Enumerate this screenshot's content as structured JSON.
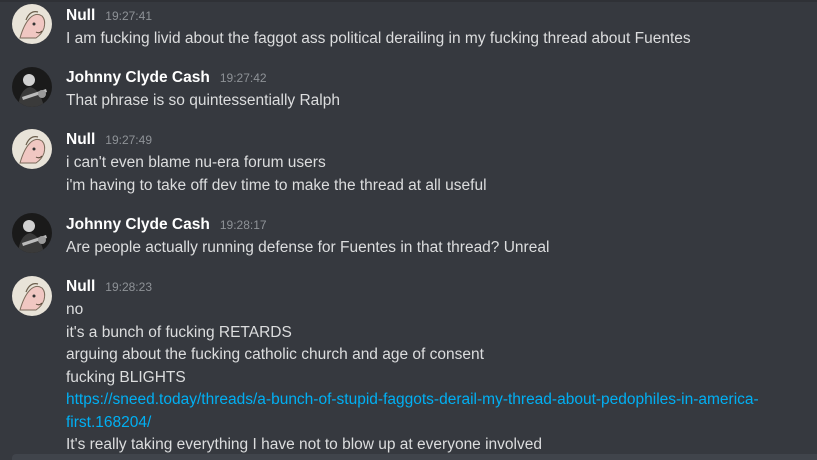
{
  "colors": {
    "background": "#36393f",
    "username": "#ffffff",
    "timestamp": "#8e9297",
    "text": "#dcddde",
    "link": "#00b0f4"
  },
  "messages": [
    {
      "author": "Null",
      "time": "19:27:41",
      "avatar": "pink-sketch-avatar",
      "lines": [
        "I am fucking livid about the faggot ass political derailing in my fucking thread about Fuentes"
      ]
    },
    {
      "author": "Johnny Clyde Cash",
      "time": "19:27:42",
      "avatar": "guitar-player-avatar",
      "lines": [
        "That phrase is so quintessentially Ralph"
      ]
    },
    {
      "author": "Null",
      "time": "19:27:49",
      "avatar": "pink-sketch-avatar",
      "lines": [
        "i can't even blame nu-era forum users",
        "i'm having to take off dev time to make the thread at all useful"
      ]
    },
    {
      "author": "Johnny Clyde Cash",
      "time": "19:28:17",
      "avatar": "guitar-player-avatar",
      "lines": [
        "Are people actually running defense for Fuentes in that thread? Unreal"
      ]
    },
    {
      "author": "Null",
      "time": "19:28:23",
      "avatar": "pink-sketch-avatar",
      "lines": [
        "no",
        "it's a bunch of fucking RETARDS",
        "arguing about the fucking catholic church and age of consent",
        "fucking BLIGHTS"
      ],
      "link": "https://sneed.today/threads/a-bunch-of-stupid-faggots-derail-my-thread-about-pedophiles-in-america-first.168204/",
      "after_link": "It's really taking everything I have not to blow up at everyone involved"
    }
  ]
}
